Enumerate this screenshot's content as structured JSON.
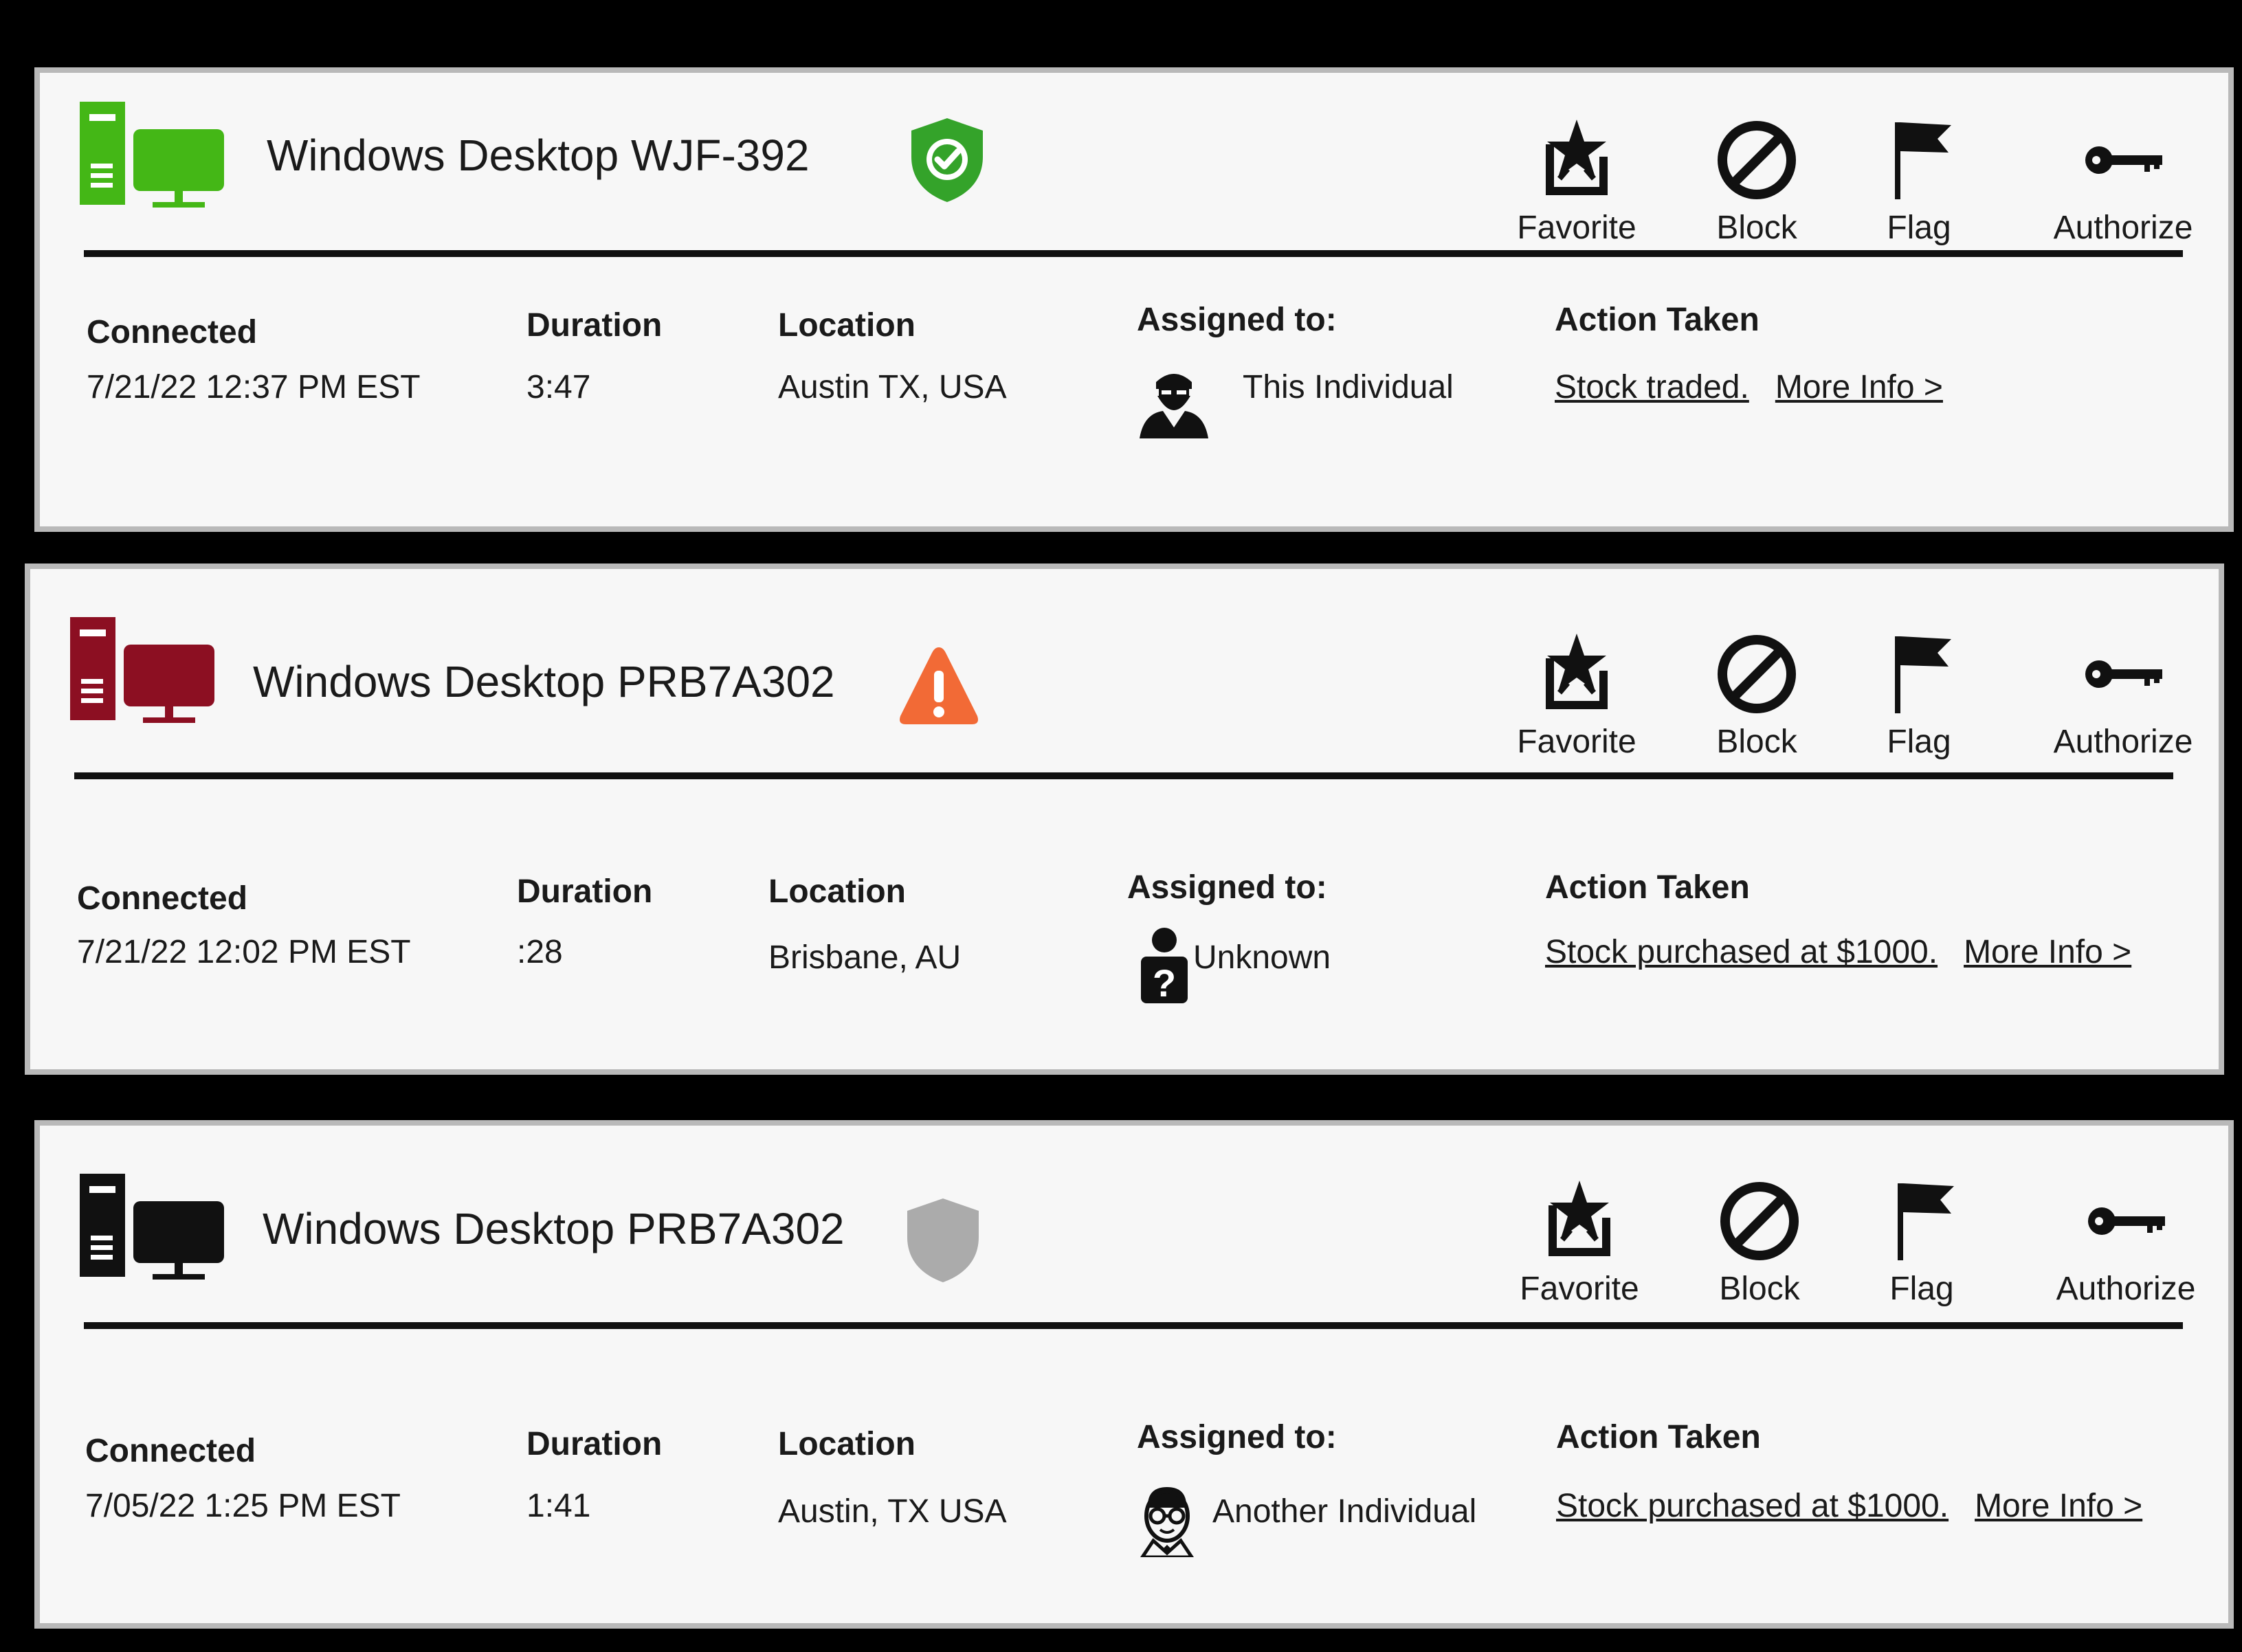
{
  "cards": [
    {
      "device_color": "#44b716",
      "title": "Windows Desktop WJF-392",
      "status_icon": "verified-shield-icon",
      "status_color": "#34a32a",
      "actions": [
        "Favorite",
        "Block",
        "Flag",
        "Authorize"
      ],
      "connected_label": "Connected",
      "connected_value": "7/21/22  12:37 PM EST",
      "duration_label": "Duration",
      "duration_value": "3:47",
      "location_label": "Location",
      "location_value": "Austin TX, USA",
      "assigned_label": "Assigned to:",
      "assigned_value": "This Individual",
      "assigned_icon": "bearded-man-icon",
      "action_label": "Action Taken",
      "action_value": "Stock traded.",
      "more_info": "More Info >"
    },
    {
      "device_color": "#8c0f22",
      "title": "Windows Desktop PRB7A302",
      "status_icon": "warning-triangle-icon",
      "status_color": "#f26a36",
      "actions": [
        "Favorite",
        "Block",
        "Flag",
        "Authorize"
      ],
      "connected_label": "Connected",
      "connected_value": "7/21/22  12:02 PM EST",
      "duration_label": "Duration",
      "duration_value": ":28",
      "location_label": "Location",
      "location_value": "Brisbane, AU",
      "assigned_label": "Assigned to:",
      "assigned_value": "Unknown",
      "assigned_icon": "unknown-person-icon",
      "action_label": "Action Taken",
      "action_value": "Stock purchased at $1000.",
      "more_info": "More Info >"
    },
    {
      "device_color": "#111111",
      "title": "Windows Desktop PRB7A302",
      "status_icon": "grey-shield-icon",
      "status_color": "#ababab",
      "actions": [
        "Favorite",
        "Block",
        "Flag",
        "Authorize"
      ],
      "connected_label": "Connected",
      "connected_value": "7/05/22  1:25 PM EST",
      "duration_label": "Duration",
      "duration_value": "1:41",
      "location_label": "Location",
      "location_value": "Austin, TX USA",
      "assigned_label": "Assigned to:",
      "assigned_value": "Another Individual",
      "assigned_icon": "glasses-man-icon",
      "action_label": "Action Taken",
      "action_value": "Stock purchased at $1000.",
      "more_info": "More Info >"
    }
  ]
}
